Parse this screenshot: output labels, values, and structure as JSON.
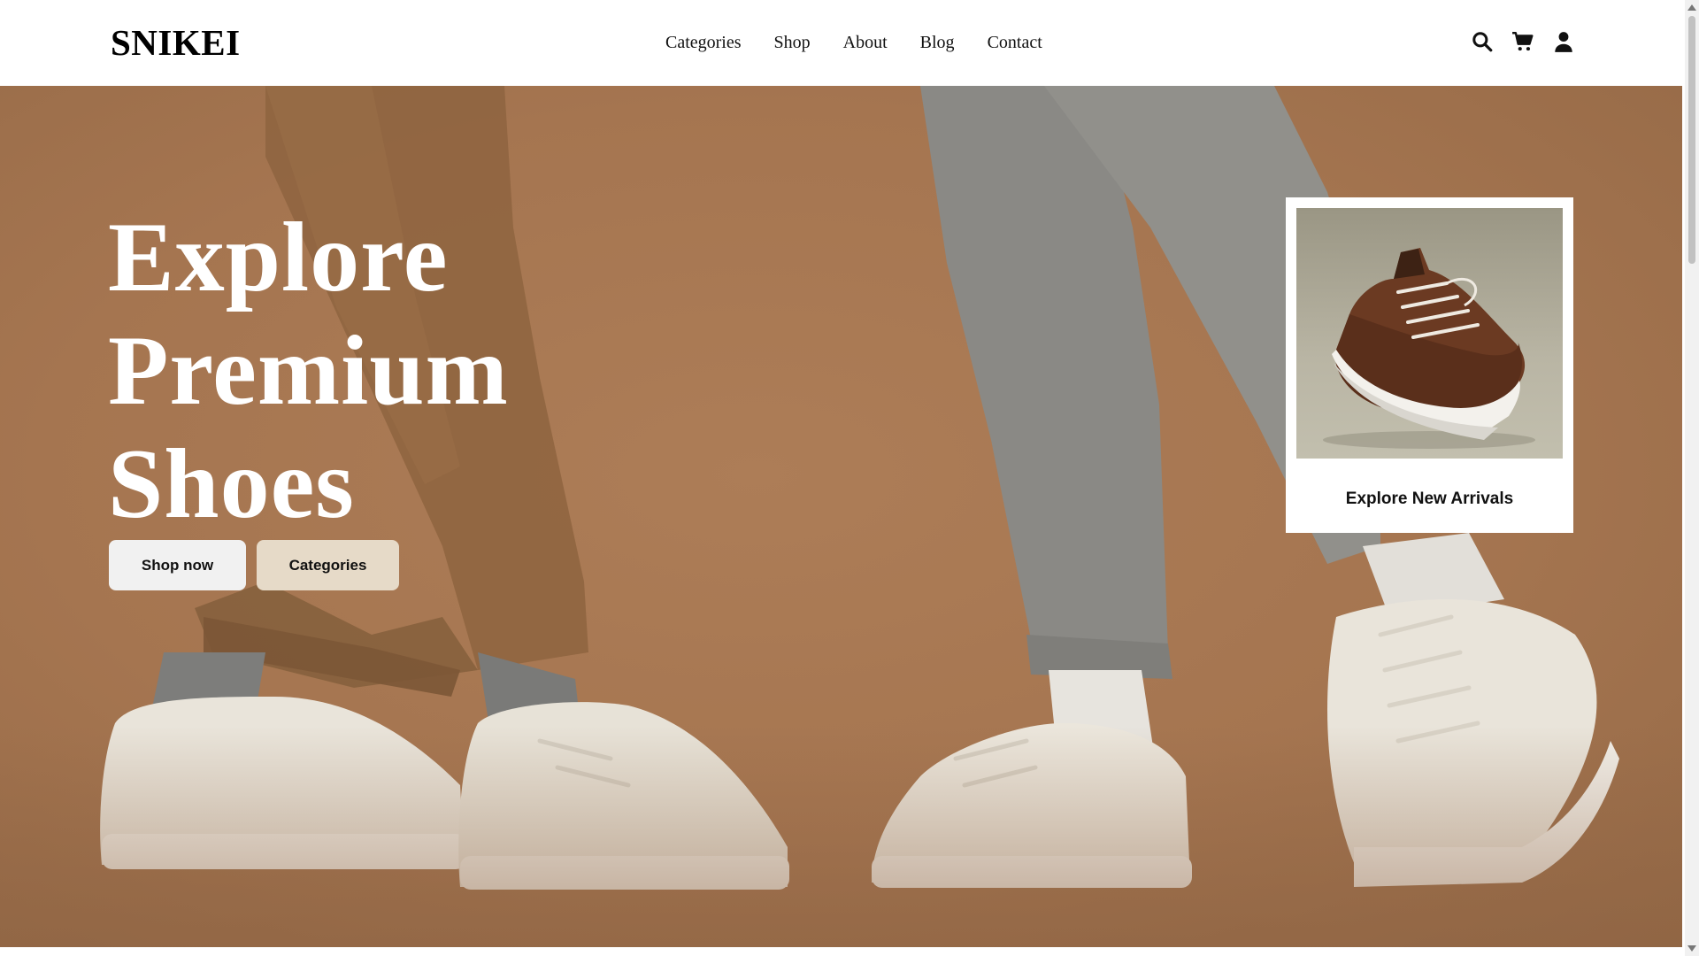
{
  "brand": {
    "logo": "SNIKEI"
  },
  "nav": {
    "items": [
      {
        "label": "Categories"
      },
      {
        "label": "Shop"
      },
      {
        "label": "About"
      },
      {
        "label": "Blog"
      },
      {
        "label": "Contact"
      }
    ]
  },
  "header_icons": [
    "search-icon",
    "cart-icon",
    "user-icon"
  ],
  "hero": {
    "title_lines": [
      "Explore",
      "Premium",
      "Shoes"
    ],
    "primary_button": "Shop now",
    "secondary_button": "Categories"
  },
  "promo_card": {
    "label": "Explore New Arrivals",
    "image": "brown-leather-sneaker"
  },
  "colors": {
    "hero_bg": "#a57550",
    "secondary_button_bg": "#e6dac8",
    "text_dark": "#111111"
  }
}
